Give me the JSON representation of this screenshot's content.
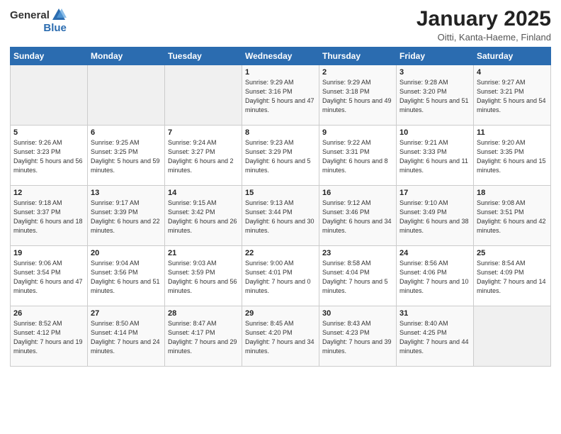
{
  "header": {
    "logo_general": "General",
    "logo_blue": "Blue",
    "title": "January 2025",
    "subtitle": "Oitti, Kanta-Haeme, Finland"
  },
  "weekdays": [
    "Sunday",
    "Monday",
    "Tuesday",
    "Wednesday",
    "Thursday",
    "Friday",
    "Saturday"
  ],
  "weeks": [
    [
      {
        "day": "",
        "info": ""
      },
      {
        "day": "",
        "info": ""
      },
      {
        "day": "",
        "info": ""
      },
      {
        "day": "1",
        "info": "Sunrise: 9:29 AM\nSunset: 3:16 PM\nDaylight: 5 hours\nand 47 minutes."
      },
      {
        "day": "2",
        "info": "Sunrise: 9:29 AM\nSunset: 3:18 PM\nDaylight: 5 hours\nand 49 minutes."
      },
      {
        "day": "3",
        "info": "Sunrise: 9:28 AM\nSunset: 3:20 PM\nDaylight: 5 hours\nand 51 minutes."
      },
      {
        "day": "4",
        "info": "Sunrise: 9:27 AM\nSunset: 3:21 PM\nDaylight: 5 hours\nand 54 minutes."
      }
    ],
    [
      {
        "day": "5",
        "info": "Sunrise: 9:26 AM\nSunset: 3:23 PM\nDaylight: 5 hours\nand 56 minutes."
      },
      {
        "day": "6",
        "info": "Sunrise: 9:25 AM\nSunset: 3:25 PM\nDaylight: 5 hours\nand 59 minutes."
      },
      {
        "day": "7",
        "info": "Sunrise: 9:24 AM\nSunset: 3:27 PM\nDaylight: 6 hours\nand 2 minutes."
      },
      {
        "day": "8",
        "info": "Sunrise: 9:23 AM\nSunset: 3:29 PM\nDaylight: 6 hours\nand 5 minutes."
      },
      {
        "day": "9",
        "info": "Sunrise: 9:22 AM\nSunset: 3:31 PM\nDaylight: 6 hours\nand 8 minutes."
      },
      {
        "day": "10",
        "info": "Sunrise: 9:21 AM\nSunset: 3:33 PM\nDaylight: 6 hours\nand 11 minutes."
      },
      {
        "day": "11",
        "info": "Sunrise: 9:20 AM\nSunset: 3:35 PM\nDaylight: 6 hours\nand 15 minutes."
      }
    ],
    [
      {
        "day": "12",
        "info": "Sunrise: 9:18 AM\nSunset: 3:37 PM\nDaylight: 6 hours\nand 18 minutes."
      },
      {
        "day": "13",
        "info": "Sunrise: 9:17 AM\nSunset: 3:39 PM\nDaylight: 6 hours\nand 22 minutes."
      },
      {
        "day": "14",
        "info": "Sunrise: 9:15 AM\nSunset: 3:42 PM\nDaylight: 6 hours\nand 26 minutes."
      },
      {
        "day": "15",
        "info": "Sunrise: 9:13 AM\nSunset: 3:44 PM\nDaylight: 6 hours\nand 30 minutes."
      },
      {
        "day": "16",
        "info": "Sunrise: 9:12 AM\nSunset: 3:46 PM\nDaylight: 6 hours\nand 34 minutes."
      },
      {
        "day": "17",
        "info": "Sunrise: 9:10 AM\nSunset: 3:49 PM\nDaylight: 6 hours\nand 38 minutes."
      },
      {
        "day": "18",
        "info": "Sunrise: 9:08 AM\nSunset: 3:51 PM\nDaylight: 6 hours\nand 42 minutes."
      }
    ],
    [
      {
        "day": "19",
        "info": "Sunrise: 9:06 AM\nSunset: 3:54 PM\nDaylight: 6 hours\nand 47 minutes."
      },
      {
        "day": "20",
        "info": "Sunrise: 9:04 AM\nSunset: 3:56 PM\nDaylight: 6 hours\nand 51 minutes."
      },
      {
        "day": "21",
        "info": "Sunrise: 9:03 AM\nSunset: 3:59 PM\nDaylight: 6 hours\nand 56 minutes."
      },
      {
        "day": "22",
        "info": "Sunrise: 9:00 AM\nSunset: 4:01 PM\nDaylight: 7 hours\nand 0 minutes."
      },
      {
        "day": "23",
        "info": "Sunrise: 8:58 AM\nSunset: 4:04 PM\nDaylight: 7 hours\nand 5 minutes."
      },
      {
        "day": "24",
        "info": "Sunrise: 8:56 AM\nSunset: 4:06 PM\nDaylight: 7 hours\nand 10 minutes."
      },
      {
        "day": "25",
        "info": "Sunrise: 8:54 AM\nSunset: 4:09 PM\nDaylight: 7 hours\nand 14 minutes."
      }
    ],
    [
      {
        "day": "26",
        "info": "Sunrise: 8:52 AM\nSunset: 4:12 PM\nDaylight: 7 hours\nand 19 minutes."
      },
      {
        "day": "27",
        "info": "Sunrise: 8:50 AM\nSunset: 4:14 PM\nDaylight: 7 hours\nand 24 minutes."
      },
      {
        "day": "28",
        "info": "Sunrise: 8:47 AM\nSunset: 4:17 PM\nDaylight: 7 hours\nand 29 minutes."
      },
      {
        "day": "29",
        "info": "Sunrise: 8:45 AM\nSunset: 4:20 PM\nDaylight: 7 hours\nand 34 minutes."
      },
      {
        "day": "30",
        "info": "Sunrise: 8:43 AM\nSunset: 4:23 PM\nDaylight: 7 hours\nand 39 minutes."
      },
      {
        "day": "31",
        "info": "Sunrise: 8:40 AM\nSunset: 4:25 PM\nDaylight: 7 hours\nand 44 minutes."
      },
      {
        "day": "",
        "info": ""
      }
    ]
  ]
}
